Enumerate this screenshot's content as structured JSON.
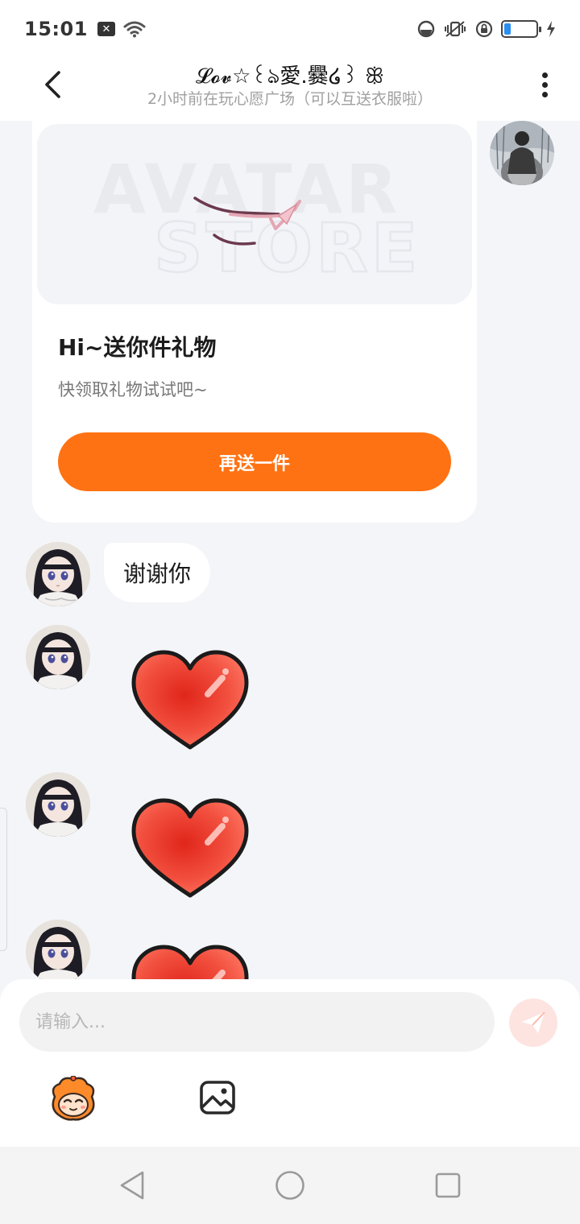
{
  "status_bar": {
    "time": "15:01"
  },
  "header": {
    "title": "𝓛𝓸𝓿☆꒰ঌ愛.爨໒꒱ ꕥ",
    "subtitle": "2小时前在玩心愿广场（可以互送衣服啦）"
  },
  "gift_card": {
    "image_text_line1": "AVATAR",
    "image_text_line2": "STORE",
    "title": "Hi~送你件礼物",
    "subtitle": "快领取礼物试试吧~",
    "button_label": "再送一件"
  },
  "messages": [
    {
      "type": "text",
      "side": "left",
      "text": "谢谢你"
    },
    {
      "type": "sticker",
      "side": "left",
      "sticker": "heart"
    },
    {
      "type": "sticker",
      "side": "left",
      "sticker": "heart"
    },
    {
      "type": "sticker",
      "side": "left",
      "sticker": "heart"
    }
  ],
  "input": {
    "placeholder": "请输入..."
  },
  "colors": {
    "accent_orange": "#ff7213",
    "send_button_bg": "#fde4e0",
    "chat_bg": "#f4f5f8"
  },
  "icons": {
    "back": "chevron-left-icon",
    "more": "more-vertical-icon",
    "send": "paper-plane-icon",
    "emoji": "emoji-mascot-icon",
    "image": "image-icon",
    "nav_back": "triangle-back-icon",
    "nav_home": "circle-home-icon",
    "nav_recent": "square-recent-icon"
  }
}
